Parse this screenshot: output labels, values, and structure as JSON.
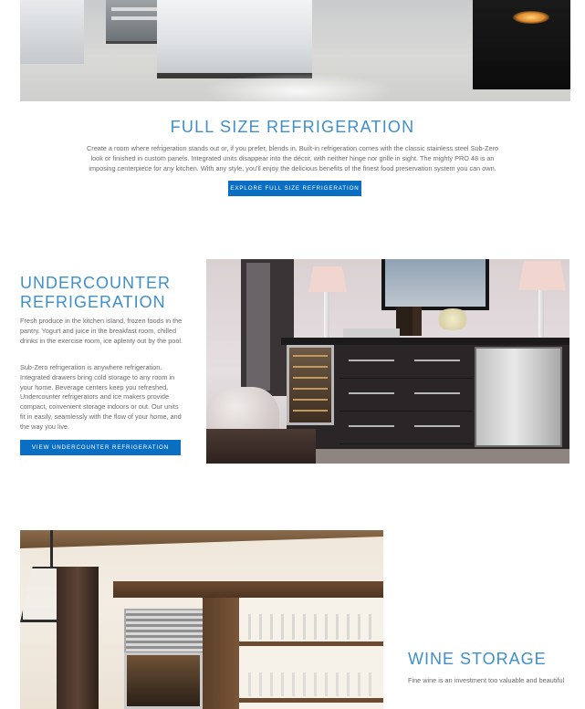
{
  "full_size": {
    "title": "FULL SIZE REFRIGERATION",
    "body": "Create a room where refrigeration stands out or, if you prefer, blends in. Built-in refrigeration comes with the classic stainless steel Sub-Zero look or finished in custom panels. Integrated units disappear into the décor, with neither hinge nor grille in sight. The mighty PRO 48 is an imposing centerpiece for any kitchen. With any style, you'll enjoy the delicious benefits of the finest food preservation system you can own.",
    "button_label": "EXPLORE FULL SIZE REFRIGERATION"
  },
  "undercounter": {
    "title": "UNDERCOUNTER REFRIGERATION",
    "paragraph1": "Fresh produce in the kitchen island, frozen foods in the pantry. Yogurt and juice in the breakfast room, chilled drinks in the exercise room, ice aplenty out by the pool.",
    "paragraph2": "Sub-Zero refrigeration is anywhere refrigeration. Integrated drawers bring cold storage to any room in your home. Beverage centers keep you refreshed. Undercounter refrigerators and ice makers provide compact, convenient storage indoors or out. Our units fit in easily, seamlessly with the flow of your home, and the way you live.",
    "button_label": "VIEW UNDERCOUNTER REFRIGERATION"
  },
  "wine_storage": {
    "title": "WINE STORAGE",
    "body": "Fine wine is an investment too valuable and beautiful"
  },
  "colors": {
    "heading": "#3f8fcb",
    "button": "#0a6fc2",
    "body_text": "#6a6a6a"
  }
}
